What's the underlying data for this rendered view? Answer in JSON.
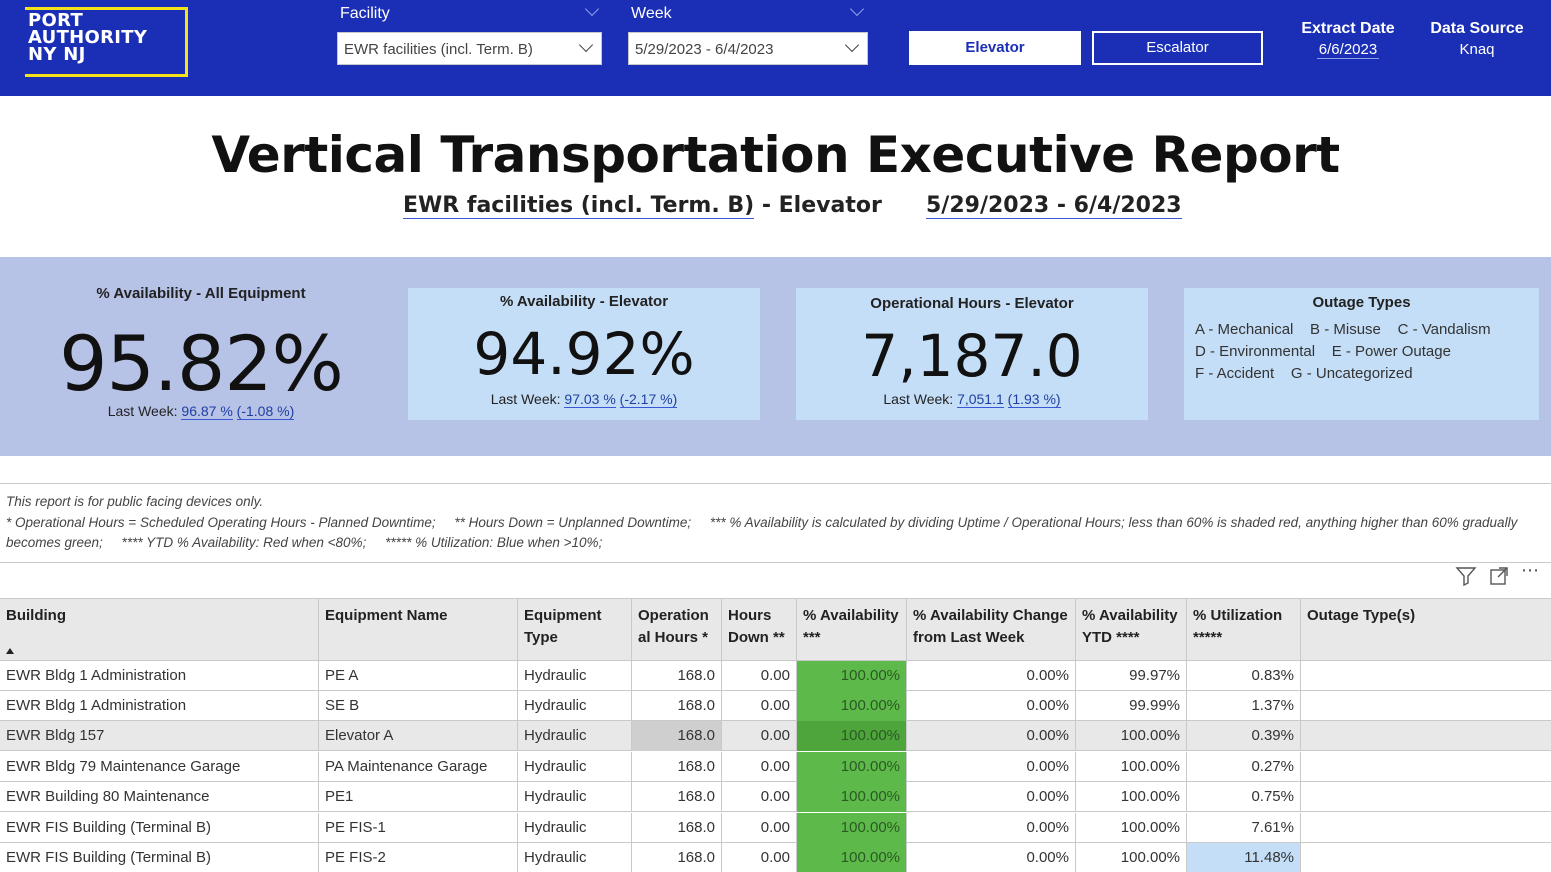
{
  "header": {
    "logo_lines": [
      "PORT",
      "AUTHORITY",
      "NY NJ"
    ],
    "facility": {
      "label": "Facility",
      "value": "EWR facilities (incl. Term. B)"
    },
    "week": {
      "label": "Week",
      "value": "5/29/2023 - 6/4/2023"
    },
    "buttons": {
      "elevator": "Elevator",
      "escalator": "Escalator"
    },
    "extract_date": {
      "label": "Extract Date",
      "value": "6/6/2023"
    },
    "data_source": {
      "label": "Data Source",
      "value": "Knaq"
    }
  },
  "report": {
    "title": "Vertical Transportation Executive Report",
    "facility_sub": "EWR facilities (incl. Term. B)",
    "equipment_sub": " - Elevator",
    "week_sub": "5/29/2023 - 6/4/2023"
  },
  "kpis": {
    "all": {
      "title": "% Availability - All Equipment",
      "value": "95.82%",
      "last_prefix": "Last Week: ",
      "last_value": "96.87 %",
      "last_change": "(-1.08 %)"
    },
    "elevator": {
      "title": "% Availability - Elevator",
      "value": "94.92%",
      "last_prefix": "Last Week: ",
      "last_value": "97.03 %",
      "last_change": "(-2.17 %)"
    },
    "hours": {
      "title": "Operational Hours - Elevator",
      "value": "7,187.0",
      "last_prefix": "Last Week: ",
      "last_value": "7,051.1",
      "last_change": "(1.93 %)"
    },
    "outage": {
      "title": "Outage Types",
      "lines": [
        "A - Mechanical    B - Misuse    C - Vandalism",
        "D - Environmental    E - Power Outage",
        "F - Accident    G - Uncategorized"
      ]
    }
  },
  "note": {
    "line1": "This report is for public facing devices only.",
    "line2": "* Operational Hours = Scheduled Operating Hours - Planned Downtime;     ** Hours Down = Unplanned Downtime;     *** % Availability is calculated by dividing Uptime / Operational Hours; less than 60% is shaded red, anything higher than 60% gradually",
    "line3": "becomes green;     **** YTD % Availability: Red when <80%;     ***** % Utilization: Blue when >10%;"
  },
  "table": {
    "columns": [
      {
        "line1": "Building",
        "line2": ""
      },
      {
        "line1": "Equipment Name",
        "line2": ""
      },
      {
        "line1": "Equipment",
        "line2": "Type"
      },
      {
        "line1": "Operation",
        "line2": "al Hours *"
      },
      {
        "line1": "Hours",
        "line2": "Down **"
      },
      {
        "line1": "% Availability",
        "line2": "***"
      },
      {
        "line1": "% Availability Change",
        "line2": "from Last Week"
      },
      {
        "line1": "% Availability",
        "line2": "YTD ****"
      },
      {
        "line1": "% Utilization",
        "line2": "*****"
      },
      {
        "line1": "Outage Type(s)",
        "line2": ""
      }
    ],
    "rows": [
      {
        "building": "EWR Bldg 1 Administration",
        "name": "PE A",
        "type": "Hydraulic",
        "ops": "168.0",
        "down": "0.00",
        "avail": "100.00%",
        "change": "0.00%",
        "ytd": "99.97%",
        "util": "0.83%",
        "outage": ""
      },
      {
        "building": "EWR Bldg 1 Administration",
        "name": "SE B",
        "type": "Hydraulic",
        "ops": "168.0",
        "down": "0.00",
        "avail": "100.00%",
        "change": "0.00%",
        "ytd": "99.99%",
        "util": "1.37%",
        "outage": ""
      },
      {
        "building": "EWR Bldg 157",
        "name": "Elevator A",
        "type": "Hydraulic",
        "ops": "168.0",
        "down": "0.00",
        "avail": "100.00%",
        "change": "0.00%",
        "ytd": "100.00%",
        "util": "0.39%",
        "outage": ""
      },
      {
        "building": "EWR Bldg 79 Maintenance Garage",
        "name": "PA Maintenance Garage",
        "type": "Hydraulic",
        "ops": "168.0",
        "down": "0.00",
        "avail": "100.00%",
        "change": "0.00%",
        "ytd": "100.00%",
        "util": "0.27%",
        "outage": ""
      },
      {
        "building": "EWR Building 80 Maintenance",
        "name": "PE1",
        "type": "Hydraulic",
        "ops": "168.0",
        "down": "0.00",
        "avail": "100.00%",
        "change": "0.00%",
        "ytd": "100.00%",
        "util": "0.75%",
        "outage": ""
      },
      {
        "building": "EWR FIS Building (Terminal B)",
        "name": "PE FIS-1",
        "type": "Hydraulic",
        "ops": "168.0",
        "down": "0.00",
        "avail": "100.00%",
        "change": "0.00%",
        "ytd": "100.00%",
        "util": "7.61%",
        "outage": ""
      },
      {
        "building": "EWR FIS Building (Terminal B)",
        "name": "PE FIS-2",
        "type": "Hydraulic",
        "ops": "168.0",
        "down": "0.00",
        "avail": "100.00%",
        "change": "0.00%",
        "ytd": "100.00%",
        "util": "11.48%",
        "outage": ""
      }
    ]
  },
  "colors": {
    "header_blue": "#1a2fb5",
    "logo_yellow": "#f4e31b",
    "kpi_band": "#b7c2e7",
    "kpi_card": "#c5def7",
    "availability_green": "#5db94a",
    "utilization_blue": "#c5def7"
  },
  "icons": [
    "filter-icon",
    "focus-mode-icon",
    "more-options-icon",
    "chevron-down-icon",
    "sort-ascending-icon"
  ]
}
